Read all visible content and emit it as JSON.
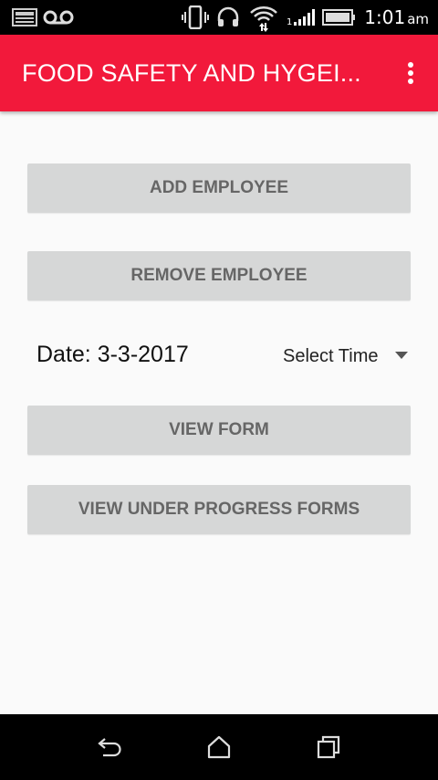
{
  "status_bar": {
    "time": "1:01",
    "ampm": "am",
    "icons": [
      "gallery-notification-icon",
      "voicemail-icon",
      "vibrate-icon",
      "headset-icon",
      "wifi-icon",
      "signal-icon",
      "battery-icon"
    ]
  },
  "app_bar": {
    "title": "FOOD SAFETY AND HYGEI...",
    "background_color": "#f2193b"
  },
  "main": {
    "add_employee_label": "ADD EMPLOYEE",
    "remove_employee_label": "REMOVE EMPLOYEE",
    "date_label": "Date: 3-3-2017",
    "time_spinner_value": "Select Time",
    "view_form_label": "VIEW FORM",
    "view_under_progress_label": "VIEW UNDER PROGRESS FORMS"
  },
  "nav_bar": {
    "icons": [
      "back-icon",
      "home-icon",
      "recent-apps-icon"
    ]
  }
}
